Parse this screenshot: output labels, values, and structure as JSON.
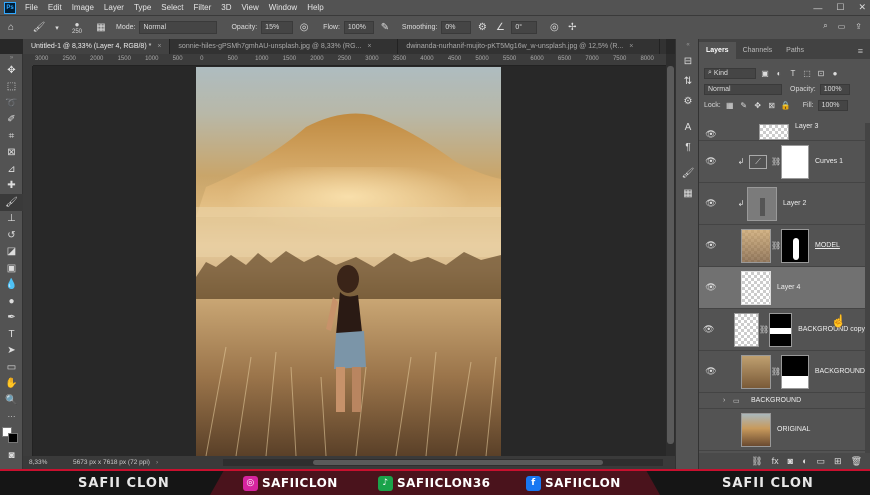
{
  "menu": [
    "File",
    "Edit",
    "Image",
    "Layer",
    "Type",
    "Select",
    "Filter",
    "3D",
    "View",
    "Window",
    "Help"
  ],
  "options": {
    "brush_size": "250",
    "mode_label": "Mode:",
    "mode_value": "Normal",
    "opacity_label": "Opacity:",
    "opacity_value": "15%",
    "flow_label": "Flow:",
    "flow_value": "100%",
    "smoothing_label": "Smoothing:",
    "smoothing_value": "0%",
    "angle_value": "0°"
  },
  "tabs": [
    {
      "label": "Untitled-1 @ 8,33% (Layer 4, RGB/8) *",
      "active": true
    },
    {
      "label": "sonnie-hiles-gPSMh7gmhAU-unsplash.jpg @ 8,33% (RG...",
      "active": false
    },
    {
      "label": "dwinanda-nurhanif-mujito-pKT5Mg16w_w-unsplash.jpg @ 12,5% (R...",
      "active": false
    }
  ],
  "ruler": [
    "3000",
    "2500",
    "2000",
    "1500",
    "1000",
    "500",
    "0",
    "500",
    "1000",
    "1500",
    "2000",
    "2500",
    "3000",
    "3500",
    "4000",
    "4500",
    "5000",
    "5500",
    "6000",
    "6500",
    "7000",
    "7500",
    "8000"
  ],
  "status": {
    "zoom": "8,33%",
    "doc": "5673 px x 7618 px (72 ppi)"
  },
  "panel": {
    "tabs": [
      "Layers",
      "Channels",
      "Paths"
    ],
    "kind": "Kind",
    "blend": "Normal",
    "opacity_label": "Opacity:",
    "opacity_value": "100%",
    "lock_label": "Lock:",
    "fill_label": "Fill:",
    "fill_value": "100%"
  },
  "layers": [
    {
      "name": "Layer 3"
    },
    {
      "name": "Curves 1"
    },
    {
      "name": "Layer 2"
    },
    {
      "name": "MODEL"
    },
    {
      "name": "Layer 4"
    },
    {
      "name": "BACKGROUND copy"
    },
    {
      "name": "BACKGROUND"
    },
    {
      "name": "BACKGROUND"
    },
    {
      "name": "ORIGINAL"
    }
  ],
  "banner": {
    "left_name": "SAFII CLON",
    "instagram": "SAFIICLON",
    "tiktok": "SAFIICLON36",
    "facebook": "SAFIICLON",
    "right_name": "SAFII CLON"
  },
  "colors": {
    "accent_red": "#c8102e",
    "instagram": "#d6249f",
    "tiktok": "#1aa34a",
    "facebook": "#1877f2"
  }
}
